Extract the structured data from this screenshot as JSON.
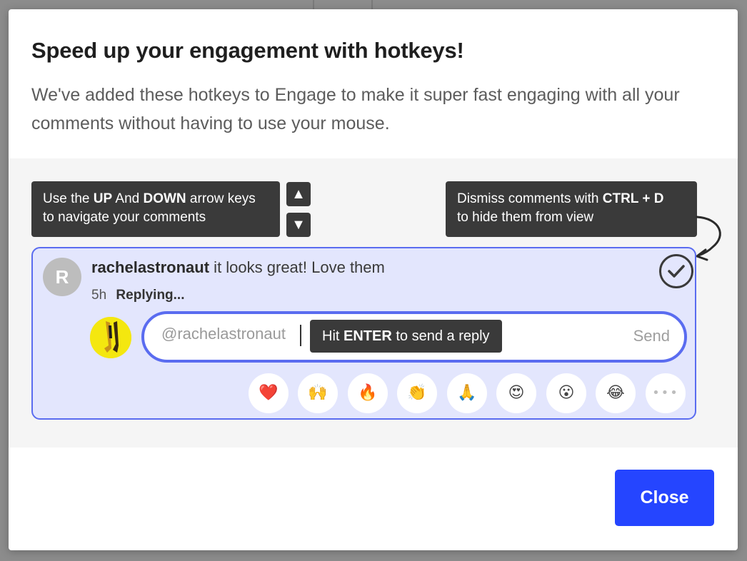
{
  "modal": {
    "title": "Speed up your engagement with hotkeys!",
    "description": "We've added these hotkeys to Engage to make it super fast engaging with all your comments without having to use your mouse.",
    "close_label": "Close"
  },
  "tooltips": {
    "navigate": {
      "prefix": "Use the ",
      "key1": "UP",
      "middle": " And ",
      "key2": "DOWN",
      "suffix": " arrow keys",
      "line2": "to navigate your comments"
    },
    "dismiss": {
      "prefix": "Dismiss comments with ",
      "keys": "CTRL + D",
      "line2": "to hide them from view"
    },
    "enter": {
      "prefix": "Hit ",
      "key": "ENTER",
      "suffix": " to send a reply"
    }
  },
  "keys": {
    "up": "▲",
    "down": "▼"
  },
  "comment": {
    "avatar_initial": "R",
    "username": "rachelastronaut",
    "text": " it looks great! Love them",
    "time": "5h",
    "status": "Replying..."
  },
  "reply": {
    "value": "@rachelastronaut",
    "send_label": "Send"
  },
  "reactions": [
    {
      "name": "heart",
      "glyph": "❤️"
    },
    {
      "name": "raised-hands",
      "glyph": "🙌"
    },
    {
      "name": "fire",
      "glyph": "🔥"
    },
    {
      "name": "clapping-hands",
      "glyph": "👏"
    },
    {
      "name": "folded-hands",
      "glyph": "🙏"
    },
    {
      "name": "heart-eyes",
      "glyph": "😍"
    },
    {
      "name": "astonished",
      "glyph": "😮"
    },
    {
      "name": "tears-of-joy",
      "glyph": "😂"
    },
    {
      "name": "more",
      "glyph": "•••"
    }
  ],
  "colors": {
    "accent": "#2545ff",
    "card_border": "#5a6cf0",
    "card_bg": "#e3e6fd",
    "tooltip_bg": "#3a3a3a"
  }
}
